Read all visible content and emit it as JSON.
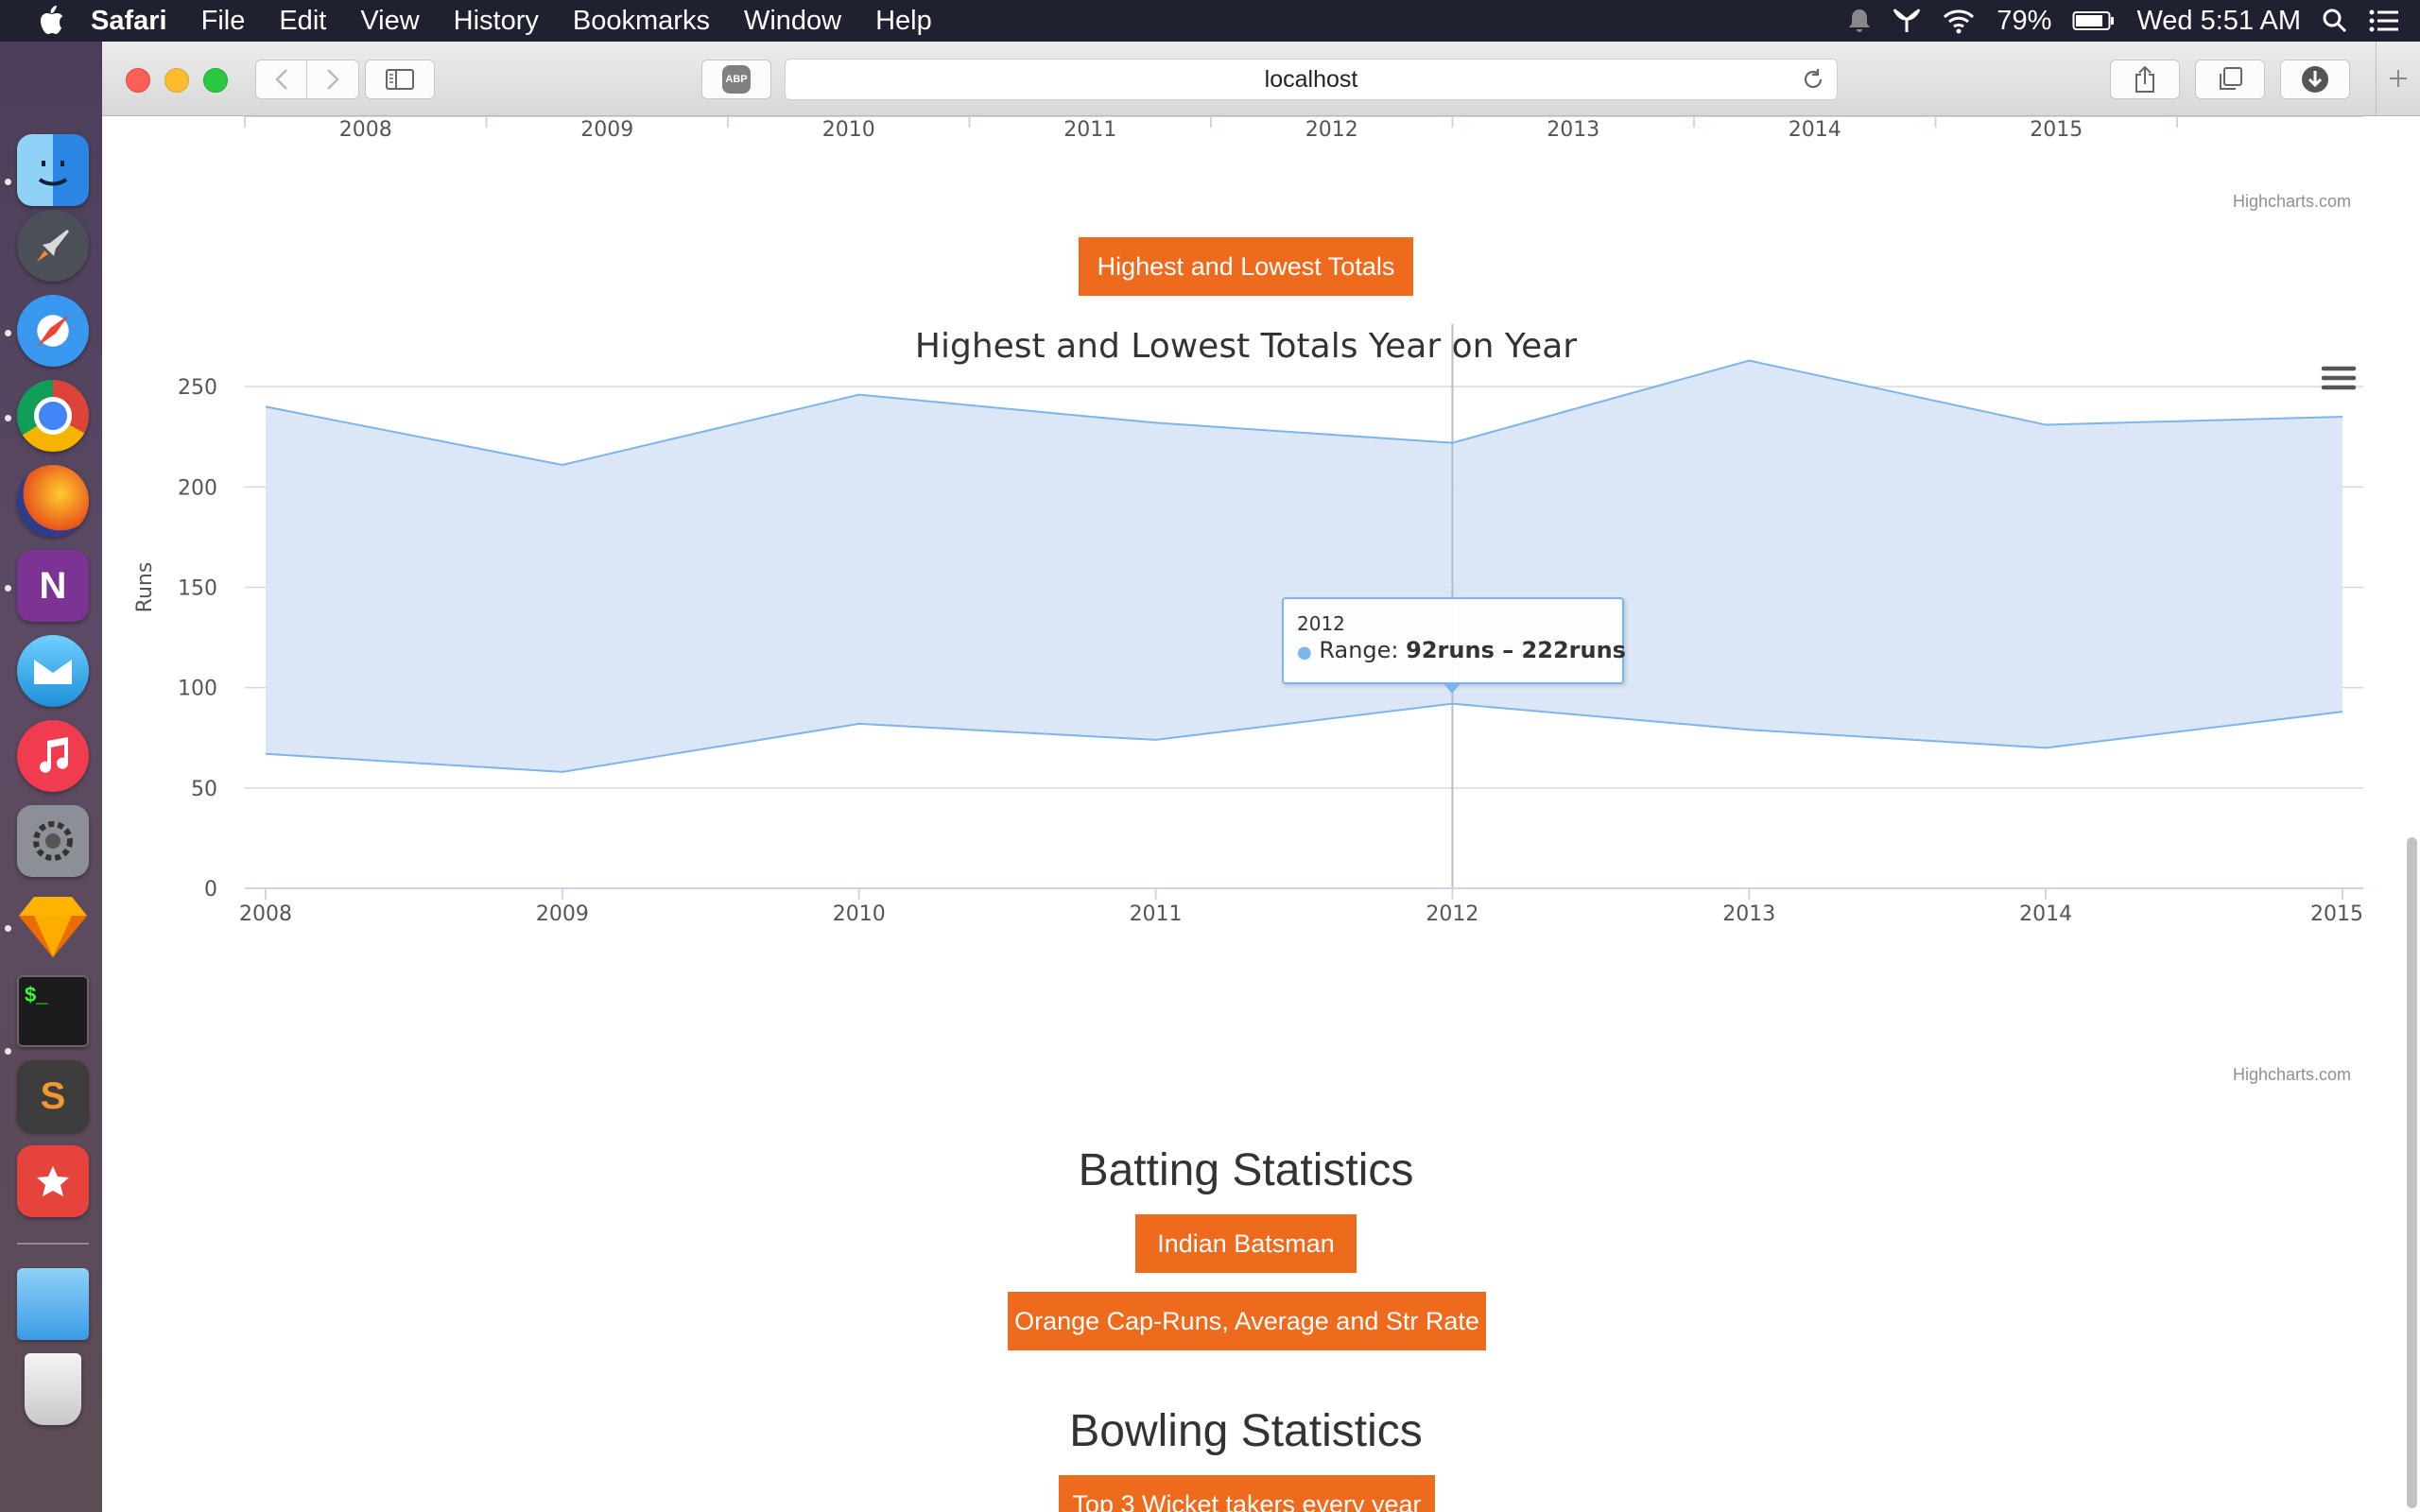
{
  "menubar": {
    "app_name": "Safari",
    "items": [
      "File",
      "Edit",
      "View",
      "History",
      "Bookmarks",
      "Window",
      "Help"
    ],
    "battery": "79%",
    "clock": "Wed 5:51 AM"
  },
  "dock": {
    "apps": [
      "Finder",
      "Launchpad",
      "Safari",
      "Chrome",
      "Firefox",
      "OneNote",
      "Airmail",
      "iTunes",
      "System Preferences",
      "Sketch",
      "Terminal",
      "Sublime Text",
      "Wunderlist",
      "Downloads",
      "Trash"
    ]
  },
  "browser": {
    "address": "localhost",
    "adblock_label": "ABP"
  },
  "top_chart": {
    "x_ticks": [
      "2008",
      "2009",
      "2010",
      "2011",
      "2012",
      "2013",
      "2014",
      "2015"
    ],
    "credits": "Highcharts.com"
  },
  "sections": {
    "totals_button": "Highest and Lowest Totals",
    "batting_heading": "Batting Statistics",
    "indian_batsman_button": "Indian Batsman",
    "orange_cap_button": "Orange Cap-Runs, Average and Str Rate",
    "bowling_heading": "Bowling Statistics",
    "wicket_takers_button": "Top 3 Wicket takers every year"
  },
  "chart_data": {
    "type": "area",
    "title": "Highest and Lowest Totals Year on Year",
    "ylabel": "Runs",
    "xlabel": "",
    "ylim": [
      0,
      300
    ],
    "y_ticks": [
      "0",
      "50",
      "100",
      "150",
      "200",
      "250",
      "300"
    ],
    "categories": [
      "2008",
      "2009",
      "2010",
      "2011",
      "2012",
      "2013",
      "2014",
      "2015"
    ],
    "low": [
      67,
      58,
      82,
      74,
      92,
      79,
      70,
      88
    ],
    "high": [
      240,
      211,
      246,
      232,
      222,
      263,
      231,
      235
    ],
    "grid": true,
    "credits": "Highcharts.com",
    "colors": {
      "fill": "#d9e6f6",
      "line": "#7cb5ec",
      "grid": "#d8d8d8"
    },
    "tooltip": {
      "header": "2012",
      "label": "Range:",
      "value": "92runs – 222runs"
    }
  }
}
